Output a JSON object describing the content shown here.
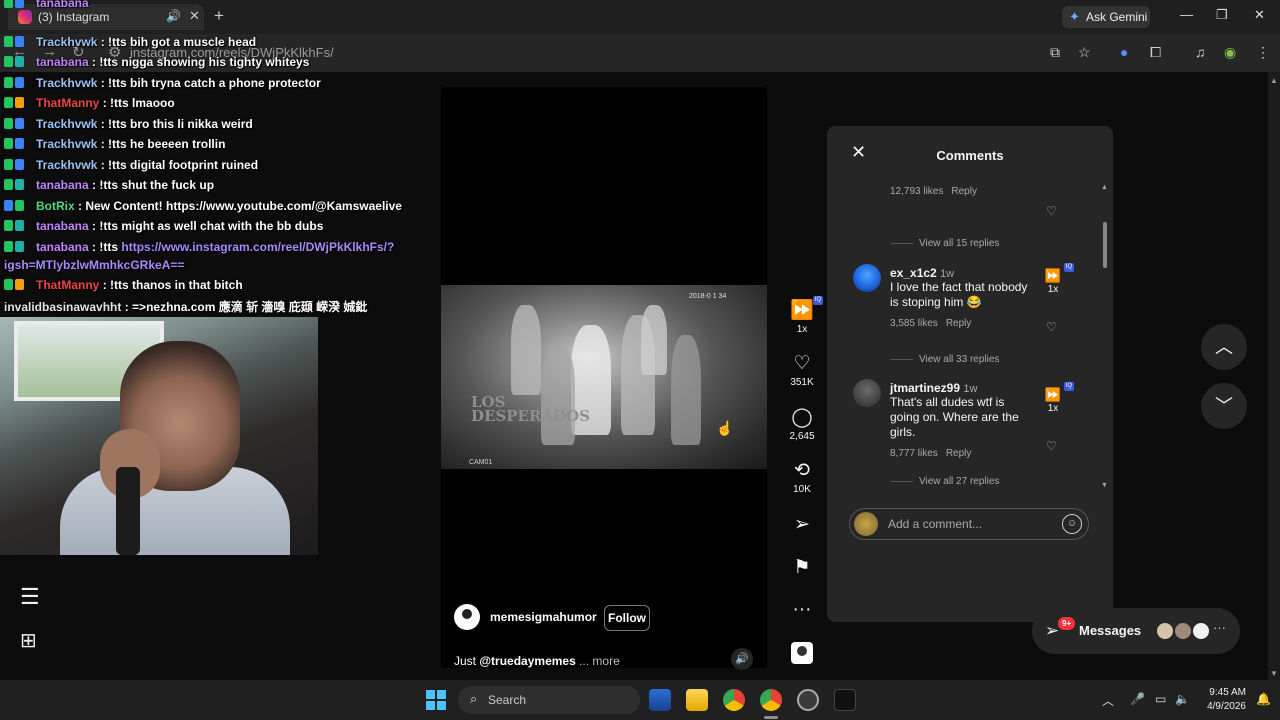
{
  "browser": {
    "tab_title": "(3) Instagram",
    "tab_audio_icon": "speaker-icon",
    "url": "instagram.com/reels/DWjPkKlkhFs/",
    "ask_gemini": "Ask Gemini"
  },
  "chat": [
    {
      "user": "tanabana",
      "msg": ": !tts bih got a muscle head",
      "color": "tana"
    },
    {
      "user": "Trackhvwk",
      "msg": ": !tts bih got a muscle head",
      "color": "track"
    },
    {
      "user": "tanabana",
      "msg": ": !tts nigga showing his tighty whiteys",
      "color": "tana"
    },
    {
      "user": "Trackhvwk",
      "msg": ": !tts bih tryna catch a phone protector",
      "color": "track"
    },
    {
      "user": "ThatManny",
      "msg": ": !tts lmaooo",
      "color": "manny"
    },
    {
      "user": "Trackhvwk",
      "msg": ": !tts bro this li nikka weird",
      "color": "track"
    },
    {
      "user": "Trackhvwk",
      "msg": ": !tts he beeeen trollin",
      "color": "track"
    },
    {
      "user": "Trackhvwk",
      "msg": ": !tts digital footprint ruined",
      "color": "track"
    },
    {
      "user": "tanabana",
      "msg": ": !tts shut the fuck up",
      "color": "tana"
    },
    {
      "user": "BotRix",
      "msg": ": New Content! https://www.youtube.com/@Kamswaelive",
      "color": "bot"
    },
    {
      "user": "tanabana",
      "msg": ": !tts might as well chat with the bb dubs",
      "color": "tana"
    },
    {
      "user": "tanabana",
      "msg": ": !tts",
      "link": "https://www.instagram.com/reel/DWjPkKlkhFs/?",
      "link2": "igsh=MTlybzlwMmhkcGRkeA==",
      "color": "tana"
    },
    {
      "user": "ThatManny",
      "msg": ": !tts thanos in that bitch",
      "color": "manny"
    },
    {
      "user": "invalidbasinawavhht",
      "msg": ": =>nezhna.com 應滴 斩 濇嗅 庇頲 嵘湀 娍鈚",
      "color": "inv"
    }
  ],
  "reel": {
    "username": "memesigmahumor",
    "follow_label": "Follow",
    "caption_prefix": "Just ",
    "caption_mention": "@truedaymemes",
    "caption_more": " ... more",
    "video_timestamp": "2018-0 1 34",
    "video_logo": "LOS\nDESPERADOS",
    "video_cam": "CAM01",
    "mute_icon": "speaker-icon"
  },
  "rail": {
    "speed": "1x",
    "likes": "351K",
    "comments": "2,645",
    "reposts": "10K"
  },
  "comments": {
    "title": "Comments",
    "items": [
      {
        "likes": "12,793 likes",
        "reply": "Reply",
        "view_replies": "View all 15 replies"
      },
      {
        "user": "ex_x1c2",
        "time": "1w",
        "text": "I love the fact that nobody is stoping him 😂",
        "likes": "3,585 likes",
        "reply": "Reply",
        "view_replies": "View all 33 replies",
        "speed": "1x"
      },
      {
        "user": "jtmartinez99",
        "time": "1w",
        "text": "That's all dudes wtf is going on. Where are the girls.",
        "likes": "8,777 likes",
        "reply": "Reply",
        "view_replies": "View all 27 replies",
        "speed": "1x"
      }
    ],
    "input_placeholder": "Add a comment..."
  },
  "messages": {
    "label": "Messages",
    "badge": "9+"
  },
  "taskbar": {
    "search_label": "Search",
    "time": "9:45 AM",
    "date": "4/9/2026"
  },
  "colors": {
    "page_bg": "#0c0c0c",
    "panel_bg": "#262626",
    "notification_red": "#ff3040",
    "chat_username_blue": "#9cc3f5",
    "chat_username_purple": "#c084fc",
    "chat_username_red": "#ef4444",
    "chat_username_green": "#4ade80"
  }
}
